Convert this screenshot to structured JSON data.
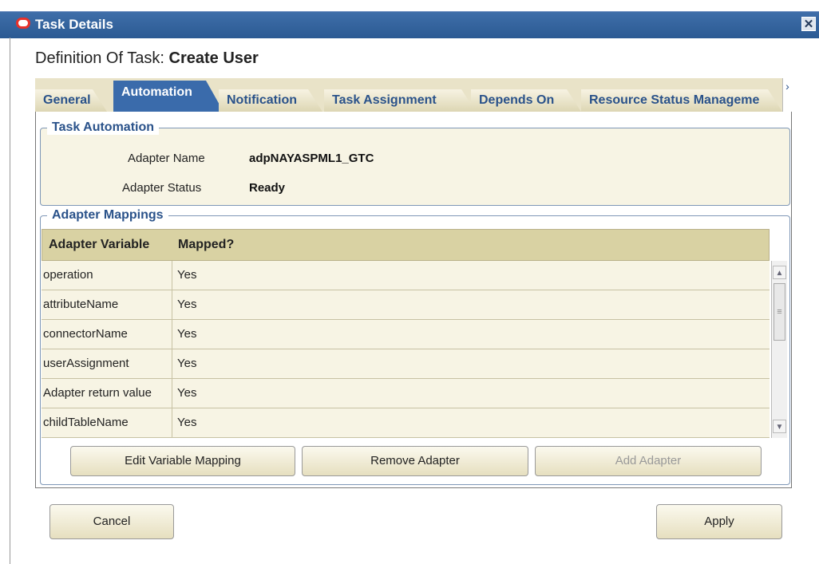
{
  "window": {
    "title": "Task Details",
    "close_glyph": "✕"
  },
  "definition": {
    "label": "Definition Of Task:",
    "task_name": "Create User"
  },
  "tabs": [
    {
      "label": "General"
    },
    {
      "label": "Automation",
      "active": true
    },
    {
      "label": "Notification"
    },
    {
      "label": "Task Assignment"
    },
    {
      "label": "Depends On"
    },
    {
      "label": "Resource Status Manageme"
    }
  ],
  "tab_scroll_glyph": "›",
  "task_automation": {
    "group_label": "Task Automation",
    "adapter_name_label": "Adapter Name",
    "adapter_name_value": "adpNAYASPML1_GTC",
    "adapter_status_label": "Adapter Status",
    "adapter_status_value": "Ready"
  },
  "adapter_mappings": {
    "group_label": "Adapter Mappings",
    "columns": [
      "Adapter Variable",
      "Mapped?"
    ],
    "rows": [
      {
        "variable": "operation",
        "mapped": "Yes"
      },
      {
        "variable": "attributeName",
        "mapped": "Yes"
      },
      {
        "variable": "connectorName",
        "mapped": "Yes"
      },
      {
        "variable": "userAssignment",
        "mapped": "Yes"
      },
      {
        "variable": "Adapter return value",
        "mapped": "Yes"
      },
      {
        "variable": "childTableName",
        "mapped": "Yes"
      }
    ],
    "buttons": {
      "edit": "Edit Variable Mapping",
      "remove": "Remove Adapter",
      "add": "Add Adapter"
    }
  },
  "footer": {
    "cancel": "Cancel",
    "apply": "Apply"
  },
  "colors": {
    "titlebar": "#2b5a93",
    "tab_active": "#3a6bab",
    "panel_bg": "#f7f4e4",
    "label_blue": "#2a528a"
  }
}
